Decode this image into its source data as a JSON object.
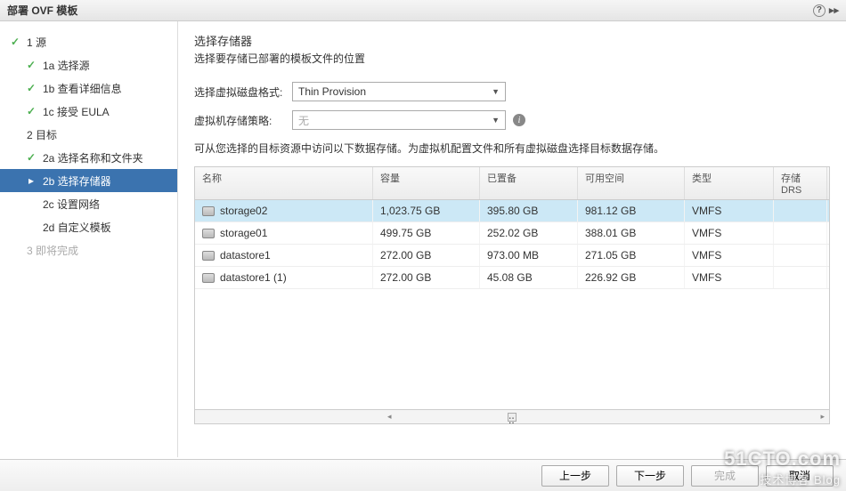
{
  "window": {
    "title": "部署 OVF 模板"
  },
  "nav": {
    "s1": "1 源",
    "s1a": "1a 选择源",
    "s1b": "1b 查看详细信息",
    "s1c": "1c 接受 EULA",
    "s2": "2 目标",
    "s2a": "2a 选择名称和文件夹",
    "s2b": "2b 选择存储器",
    "s2c": "2c 设置网络",
    "s2d": "2d 自定义模板",
    "s3": "3 即将完成"
  },
  "panel": {
    "title": "选择存储器",
    "desc": "选择要存储已部署的模板文件的位置",
    "format_label": "选择虚拟磁盘格式:",
    "format_value": "Thin Provision",
    "policy_label": "虚拟机存储策略:",
    "policy_value": "无",
    "instruction": "可从您选择的目标资源中访问以下数据存储。为虚拟机配置文件和所有虚拟磁盘选择目标数据存储。"
  },
  "table": {
    "headers": {
      "name": "名称",
      "capacity": "容量",
      "provisioned": "已置备",
      "free": "可用空间",
      "type": "类型",
      "drs": "存储 DRS"
    },
    "rows": [
      {
        "name": "storage02",
        "capacity": "1,023.75 GB",
        "provisioned": "395.80 GB",
        "free": "981.12 GB",
        "type": "VMFS",
        "selected": true
      },
      {
        "name": "storage01",
        "capacity": "499.75 GB",
        "provisioned": "252.02 GB",
        "free": "388.01 GB",
        "type": "VMFS",
        "selected": false
      },
      {
        "name": "datastore1",
        "capacity": "272.00 GB",
        "provisioned": "973.00 MB",
        "free": "271.05 GB",
        "type": "VMFS",
        "selected": false
      },
      {
        "name": "datastore1 (1)",
        "capacity": "272.00 GB",
        "provisioned": "45.08 GB",
        "free": "226.92 GB",
        "type": "VMFS",
        "selected": false
      }
    ]
  },
  "footer": {
    "back": "上一步",
    "next": "下一步",
    "finish": "完成",
    "cancel": "取消"
  },
  "watermark": {
    "main": "51CTO.com",
    "sub": "技术博客  Blog"
  }
}
